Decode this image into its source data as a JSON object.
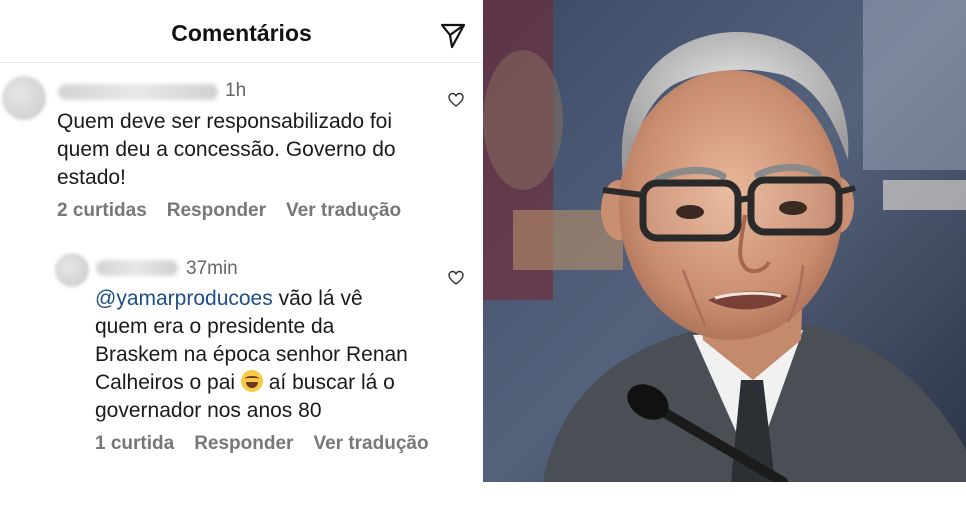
{
  "header": {
    "title": "Comentários"
  },
  "comments": [
    {
      "time": "1h",
      "text_lines": [
        "Quem deve ser responsabilizado foi",
        "quem deu a concessão. Governo do",
        "estado!"
      ],
      "likes": "2 curtidas",
      "reply": "Responder",
      "translate": "Ver tradução"
    },
    {
      "time": "37min",
      "mention": "@yamarproducoes",
      "line1_rest": " vão lá vê",
      "line2": "quem era o presidente da",
      "line3": "Braskem na época senhor Renan",
      "line4_a": "Calheiros o pai ",
      "line4_b": " aí buscar lá o",
      "line5": "governador nos anos 80",
      "likes": "1 curtida",
      "reply": "Responder",
      "translate": "Ver tradução"
    }
  ],
  "icons": {
    "send": "send-icon",
    "heart": "heart-icon",
    "emoji": "laughing-tears-emoji"
  },
  "colors": {
    "mention": "#1e4e86",
    "meta_text": "#777777",
    "background": "#ffffff"
  }
}
